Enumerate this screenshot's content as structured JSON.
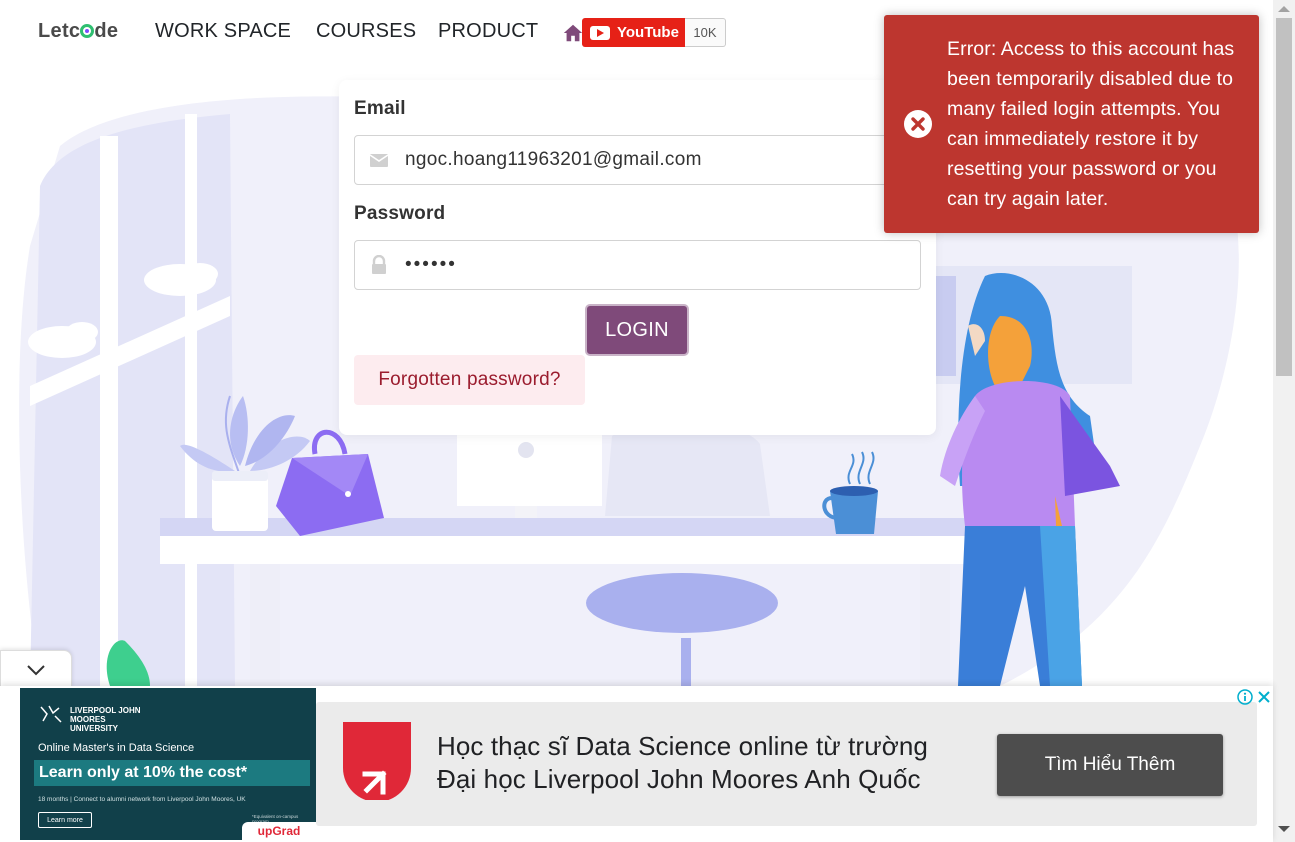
{
  "header": {
    "logo_text": "Letcode",
    "nav": [
      {
        "label": "WORK SPACE"
      },
      {
        "label": "COURSES"
      },
      {
        "label": "PRODUCT"
      }
    ],
    "youtube": {
      "label": "YouTube",
      "count": "10K"
    }
  },
  "login": {
    "email_label": "Email",
    "email_value": "ngoc.hoang11963201@gmail.com",
    "password_label": "Password",
    "password_value": "••••••",
    "login_button": "LOGIN",
    "forgot_link": "Forgotten password?"
  },
  "error_toast": {
    "message": "Error: Access to this account has been temporarily disabled due to many failed login attempts. You can immediately restore it by resetting your password or you can try again later.",
    "color": "#bd362f"
  },
  "ad": {
    "university": "LIVERPOOL JOHN MOORES UNIVERSITY",
    "program": "Online Master's in Data Science",
    "offer": "Learn only at 10% the cost*",
    "note": "18 months | Connect to alumni network from Liverpool John Moores, UK",
    "learn_more": "Learn more",
    "fine_print": "*Equivalent on-campus program",
    "partner": "upGrad",
    "headline_line1": "Học thạc sĩ Data Science online từ trường",
    "headline_line2": "Đại học Liverpool John Moores Anh Quốc",
    "cta": "Tìm Hiểu Thêm"
  },
  "colors": {
    "login_button": "#7f4a7a",
    "forgot_bg": "#fdecef",
    "accent_purple": "#8c6cf2"
  }
}
